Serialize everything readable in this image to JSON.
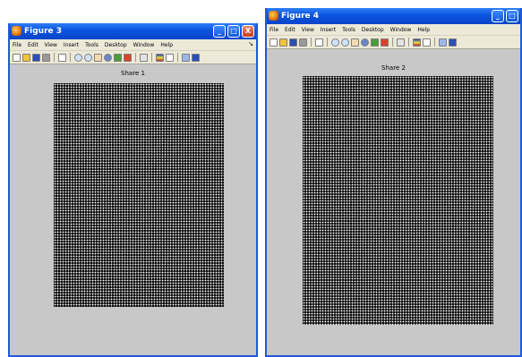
{
  "figures": [
    {
      "title": "Figure 3",
      "menu": [
        "File",
        "Edit",
        "View",
        "Insert",
        "Tools",
        "Desktop",
        "Window",
        "Help"
      ],
      "menu_arrow": "↘",
      "window_buttons": {
        "minimize": "_",
        "maximize": "□",
        "close": "X"
      },
      "plot_title": "Share 1"
    },
    {
      "title": "Figure 4",
      "menu": [
        "File",
        "Edit",
        "View",
        "Insert",
        "Tools",
        "Desktop",
        "Window",
        "Help"
      ],
      "window_buttons": {
        "minimize": "_",
        "maximize": "□"
      },
      "plot_title": "Share 2"
    }
  ],
  "toolbar_icons": [
    "new-figure-icon",
    "open-file-icon",
    "save-figure-icon",
    "print-figure-icon",
    "edit-plot-icon",
    "zoom-in-icon",
    "zoom-out-icon",
    "pan-icon",
    "rotate-3d-icon",
    "data-cursor-icon",
    "brush-icon",
    "link-plot-icon",
    "insert-colorbar-icon",
    "insert-legend-icon",
    "hide-plot-tools-icon",
    "show-plot-tools-icon"
  ],
  "colors": {
    "title_bar": "#0a53e0",
    "figure_background": "#c8c8c8",
    "toolbar": "#ece9d8"
  }
}
